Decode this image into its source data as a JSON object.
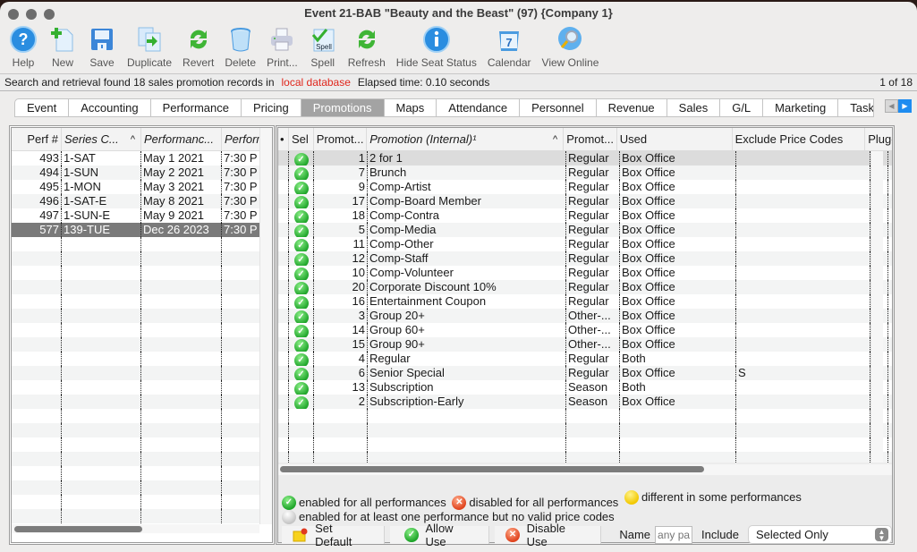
{
  "window": {
    "title": "Event 21-BAB \"Beauty and the Beast\" (97) {Company 1}"
  },
  "toolbar": [
    {
      "label": "Help",
      "icon": "help-icon"
    },
    {
      "label": "New",
      "icon": "new-document-icon"
    },
    {
      "label": "Save",
      "icon": "floppy-disk-icon"
    },
    {
      "label": "Duplicate",
      "icon": "duplicate-icon"
    },
    {
      "label": "Revert",
      "icon": "revert-arrows-icon"
    },
    {
      "label": "Delete",
      "icon": "trash-can-icon"
    },
    {
      "label": "Print...",
      "icon": "printer-icon"
    },
    {
      "label": "Spell",
      "icon": "spell-check-icon"
    },
    {
      "label": "Refresh",
      "icon": "refresh-arrows-icon"
    },
    {
      "label": "Hide Seat Status",
      "icon": "info-icon"
    },
    {
      "label": "Calendar",
      "icon": "calendar-icon"
    },
    {
      "label": "View Online",
      "icon": "globe-magnifier-icon"
    }
  ],
  "status": {
    "message": "Search and retrieval found 18 sales promotion records in",
    "source": "local database",
    "elapsed": "Elapsed time: 0.10 seconds",
    "record_position": "1 of 18"
  },
  "tabs": [
    {
      "label": "Event"
    },
    {
      "label": "Accounting"
    },
    {
      "label": "Performance"
    },
    {
      "label": "Pricing"
    },
    {
      "label": "Promotions",
      "active": true
    },
    {
      "label": "Maps"
    },
    {
      "label": "Attendance"
    },
    {
      "label": "Personnel"
    },
    {
      "label": "Revenue"
    },
    {
      "label": "Sales"
    },
    {
      "label": "G/L"
    },
    {
      "label": "Marketing"
    },
    {
      "label": "Task"
    }
  ],
  "performances": {
    "columns": [
      "Perf #",
      "Series C...",
      "Performanc...",
      "Performa"
    ],
    "sort_indicator": "^",
    "rows": [
      [
        "493",
        "1-SAT",
        "May 1 2021",
        "7:30 P"
      ],
      [
        "494",
        "1-SUN",
        "May 2 2021",
        "7:30 P"
      ],
      [
        "495",
        "1-MON",
        "May 3 2021",
        "7:30 P"
      ],
      [
        "496",
        "1-SAT-E",
        "May 8 2021",
        "7:30 P"
      ],
      [
        "497",
        "1-SUN-E",
        "May 9 2021",
        "7:30 P"
      ],
      [
        "577",
        "139-TUE",
        "Dec 26 2023",
        "7:30 P"
      ]
    ],
    "selected_row": 5
  },
  "promotions": {
    "columns": [
      "•",
      "Sel",
      "Promot...",
      "Promotion (Internal)¹",
      "Promot...",
      "Used",
      "Exclude Price Codes",
      "Plug-I"
    ],
    "sort_indicator": "^",
    "rows": [
      {
        "sel": "enabled",
        "id": "1",
        "name": "2 for 1",
        "type": "Regular",
        "used": "Box Office",
        "exclude": ""
      },
      {
        "sel": "enabled",
        "id": "7",
        "name": "Brunch",
        "type": "Regular",
        "used": "Box Office",
        "exclude": ""
      },
      {
        "sel": "enabled",
        "id": "9",
        "name": "Comp-Artist",
        "type": "Regular",
        "used": "Box Office",
        "exclude": ""
      },
      {
        "sel": "enabled",
        "id": "17",
        "name": "Comp-Board Member",
        "type": "Regular",
        "used": "Box Office",
        "exclude": ""
      },
      {
        "sel": "enabled",
        "id": "18",
        "name": "Comp-Contra",
        "type": "Regular",
        "used": "Box Office",
        "exclude": ""
      },
      {
        "sel": "enabled",
        "id": "5",
        "name": "Comp-Media",
        "type": "Regular",
        "used": "Box Office",
        "exclude": ""
      },
      {
        "sel": "enabled",
        "id": "11",
        "name": "Comp-Other",
        "type": "Regular",
        "used": "Box Office",
        "exclude": ""
      },
      {
        "sel": "enabled",
        "id": "12",
        "name": "Comp-Staff",
        "type": "Regular",
        "used": "Box Office",
        "exclude": ""
      },
      {
        "sel": "enabled",
        "id": "10",
        "name": "Comp-Volunteer",
        "type": "Regular",
        "used": "Box Office",
        "exclude": ""
      },
      {
        "sel": "enabled",
        "id": "20",
        "name": "Corporate Discount 10%",
        "type": "Regular",
        "used": "Box Office",
        "exclude": ""
      },
      {
        "sel": "enabled",
        "id": "16",
        "name": "Entertainment Coupon",
        "type": "Regular",
        "used": "Box Office",
        "exclude": ""
      },
      {
        "sel": "enabled",
        "id": "3",
        "name": "Group 20+",
        "type": "Other-...",
        "used": "Box Office",
        "exclude": ""
      },
      {
        "sel": "enabled",
        "id": "14",
        "name": "Group 60+",
        "type": "Other-...",
        "used": "Box Office",
        "exclude": ""
      },
      {
        "sel": "enabled",
        "id": "15",
        "name": "Group 90+",
        "type": "Other-...",
        "used": "Box Office",
        "exclude": ""
      },
      {
        "sel": "enabled",
        "id": "4",
        "name": "Regular",
        "type": "Regular",
        "used": "Both",
        "exclude": ""
      },
      {
        "sel": "enabled",
        "id": "6",
        "name": "Senior Special",
        "type": "Regular",
        "used": "Box Office",
        "exclude": "S"
      },
      {
        "sel": "enabled",
        "id": "13",
        "name": "Subscription",
        "type": "Season",
        "used": "Both",
        "exclude": ""
      },
      {
        "sel": "enabled",
        "id": "2",
        "name": "Subscription-Early",
        "type": "Season",
        "used": "Box Office",
        "exclude": ""
      }
    ],
    "selected_row": 0
  },
  "legend": {
    "enabled_all": "enabled for all performances",
    "disabled_all": "disabled for all performances",
    "different_some": "different in some performances",
    "no_valid_price": "enabled for at least one performance but no valid price codes"
  },
  "bottom": {
    "set_default": "Set Default",
    "allow_use": "Allow Use",
    "disable_use": "Disable Use",
    "name_label": "Name",
    "name_placeholder": "any part",
    "include_label": "Include",
    "include_value": "Selected Only"
  }
}
